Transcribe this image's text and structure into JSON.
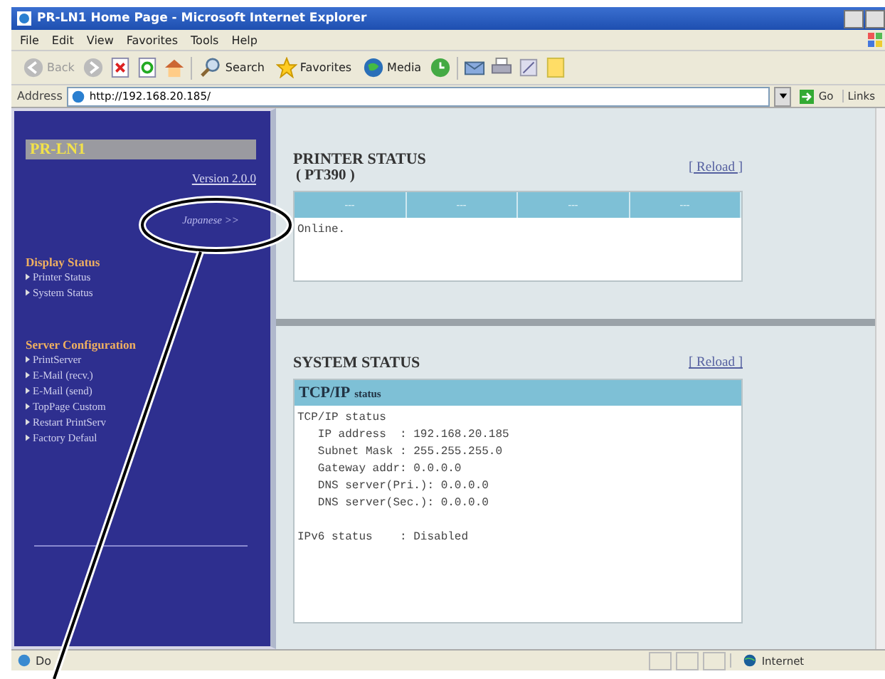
{
  "window": {
    "title": "PR-LN1 Home Page - Microsoft Internet Explorer"
  },
  "menu": [
    "File",
    "Edit",
    "View",
    "Favorites",
    "Tools",
    "Help"
  ],
  "toolbar": {
    "back": {
      "label": "Back",
      "disabled": true
    },
    "search": "Search",
    "favorites": "Favorites",
    "media": "Media"
  },
  "address_bar": {
    "label": "Address",
    "value": "http://192.168.20.185/",
    "go": "Go",
    "links": "Links"
  },
  "sidebar": {
    "logo": "PR-LN1",
    "version": "Version 2.0.0",
    "language_link": "Japanese >>",
    "sections": [
      {
        "title": "Display Status",
        "items": [
          "Printer Status",
          "System Status"
        ]
      },
      {
        "title": "Server Configuration",
        "items": [
          "PrintServer",
          "E-Mail (recv.)",
          "E-Mail (send)",
          "TopPage Custom",
          "Restart PrintServ",
          "Factory Defaul"
        ]
      }
    ]
  },
  "printer_status": {
    "title": "PRINTER STATUS",
    "model": "( PT390 )",
    "reload": "[ Reload ]",
    "columns": [
      "---",
      "---",
      "---",
      "---"
    ],
    "message": "Online."
  },
  "system_status": {
    "title": "SYSTEM STATUS",
    "reload": "[ Reload ]",
    "panel_title": "TCP/IP",
    "panel_subtitle": "status",
    "lines": [
      "TCP/IP status",
      "   IP address  : 192.168.20.185",
      "   Subnet Mask : 255.255.255.0",
      "   Gateway addr: 0.0.0.0",
      "   DNS server(Pri.): 0.0.0.0",
      "   DNS server(Sec.): 0.0.0.0"
    ],
    "ipv6_line": "IPv6 status    : Disabled"
  },
  "status_bar": {
    "text": "Do",
    "zone": "Internet"
  }
}
